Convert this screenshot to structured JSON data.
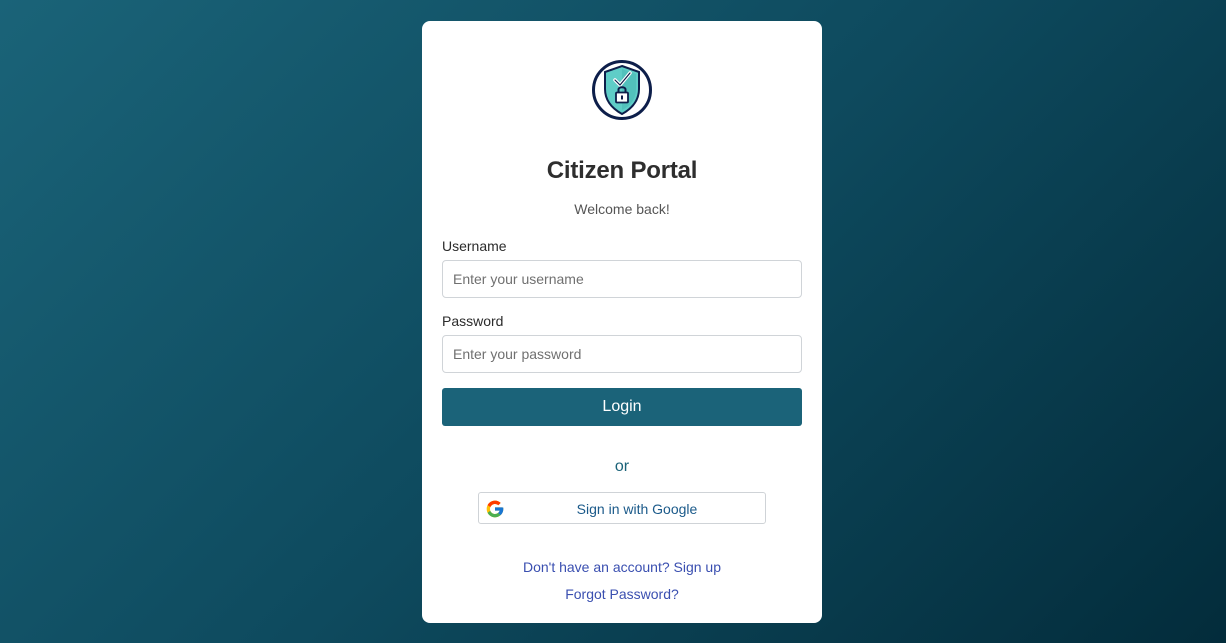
{
  "app": {
    "title": "Citizen Portal",
    "subtitle": "Welcome back!"
  },
  "logo": {
    "icon": "shield-lock-check-icon"
  },
  "form": {
    "username_label": "Username",
    "username_placeholder": "Enter your username",
    "username_value": "",
    "password_label": "Password",
    "password_placeholder": "Enter your password",
    "password_value": "",
    "login_label": "Login"
  },
  "divider": {
    "text": "or"
  },
  "google": {
    "label": "Sign in with Google",
    "icon": "google-g-icon"
  },
  "links": {
    "signup": "Don't have an account? Sign up",
    "forgot": "Forgot Password?"
  },
  "colors": {
    "primary": "#1b6379",
    "link": "#3a4fb0",
    "background_start": "#1a6378",
    "background_end": "#032c3b"
  }
}
